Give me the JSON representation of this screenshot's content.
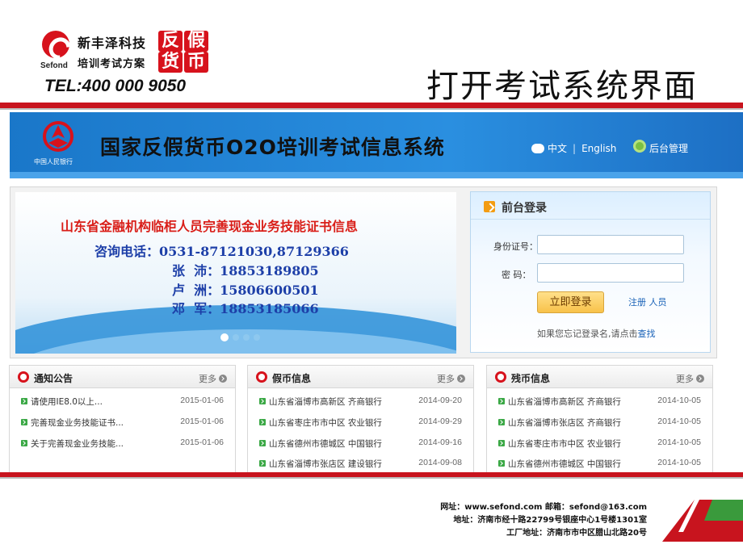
{
  "slide": {
    "company_name": "新丰泽科技",
    "company_tagline": "培训考试方案",
    "brand_char_1": "反",
    "brand_char_2": "假",
    "brand_char_3": "货",
    "brand_char_4": "币",
    "logo_text": "Sefond",
    "tel": "TEL:400 000 9050",
    "title": "打开考试系统界面"
  },
  "banner": {
    "bank_name": "中国人民银行",
    "system_title": "国家反假货币O2O培训考试信息系统",
    "lang_zh": "中文",
    "lang_en": "English",
    "admin_label": "后台管理"
  },
  "info_slide": {
    "headline": "山东省金融机构临柜人员完善现金业务技能证书信息",
    "phone_line": "咨询电话：0531-87121030,87129366",
    "contact_1": "张  沛：18853189805",
    "contact_2": "卢  洲：15806600501",
    "contact_3": "邓  军：18853185066"
  },
  "login": {
    "title": "前台登录",
    "id_label": "身份证号：",
    "pwd_label": "密  码：",
    "id_value": "",
    "pwd_value": "",
    "submit_label": "立即登录",
    "register_label": "注册 人员",
    "forgot_text": "如果您忘记登录名,请点击",
    "forgot_link": "查找"
  },
  "news": {
    "more_label": "更多",
    "notices": {
      "title": "通知公告",
      "items": [
        {
          "text": "请使用IE8.0以上...",
          "date": "2015-01-06"
        },
        {
          "text": "完善现金业务技能证书...",
          "date": "2015-01-06"
        },
        {
          "text": "关于完善现金业务技能...",
          "date": "2015-01-06"
        }
      ]
    },
    "counterfeit": {
      "title": "假币信息",
      "items": [
        {
          "text": "山东省淄博市高新区 齐商银行",
          "date": "2014-09-20"
        },
        {
          "text": "山东省枣庄市市中区 农业银行",
          "date": "2014-09-29"
        },
        {
          "text": "山东省德州市德城区 中国银行",
          "date": "2014-09-16"
        },
        {
          "text": "山东省淄博市张店区 建设银行",
          "date": "2014-09-08"
        }
      ]
    },
    "damaged": {
      "title": "残币信息",
      "items": [
        {
          "text": "山东省淄博市高新区 齐商银行",
          "date": "2014-10-05"
        },
        {
          "text": "山东省淄博市张店区 齐商银行",
          "date": "2014-10-05"
        },
        {
          "text": "山东省枣庄市市中区 农业银行",
          "date": "2014-10-05"
        },
        {
          "text": "山东省德州市德城区 中国银行",
          "date": "2014-10-05"
        }
      ]
    }
  },
  "footer": {
    "website": "网址：www.sefond.com     邮箱：sefond@163.com",
    "address": "地址：济南市经十路22799号银座中心1号楼1301室",
    "factory": "工厂地址：济南市市中区腊山北路20号"
  },
  "colors": {
    "brand_red": "#c8141e",
    "banner_blue": "#1a77c9",
    "link_blue": "#1a62b8"
  }
}
